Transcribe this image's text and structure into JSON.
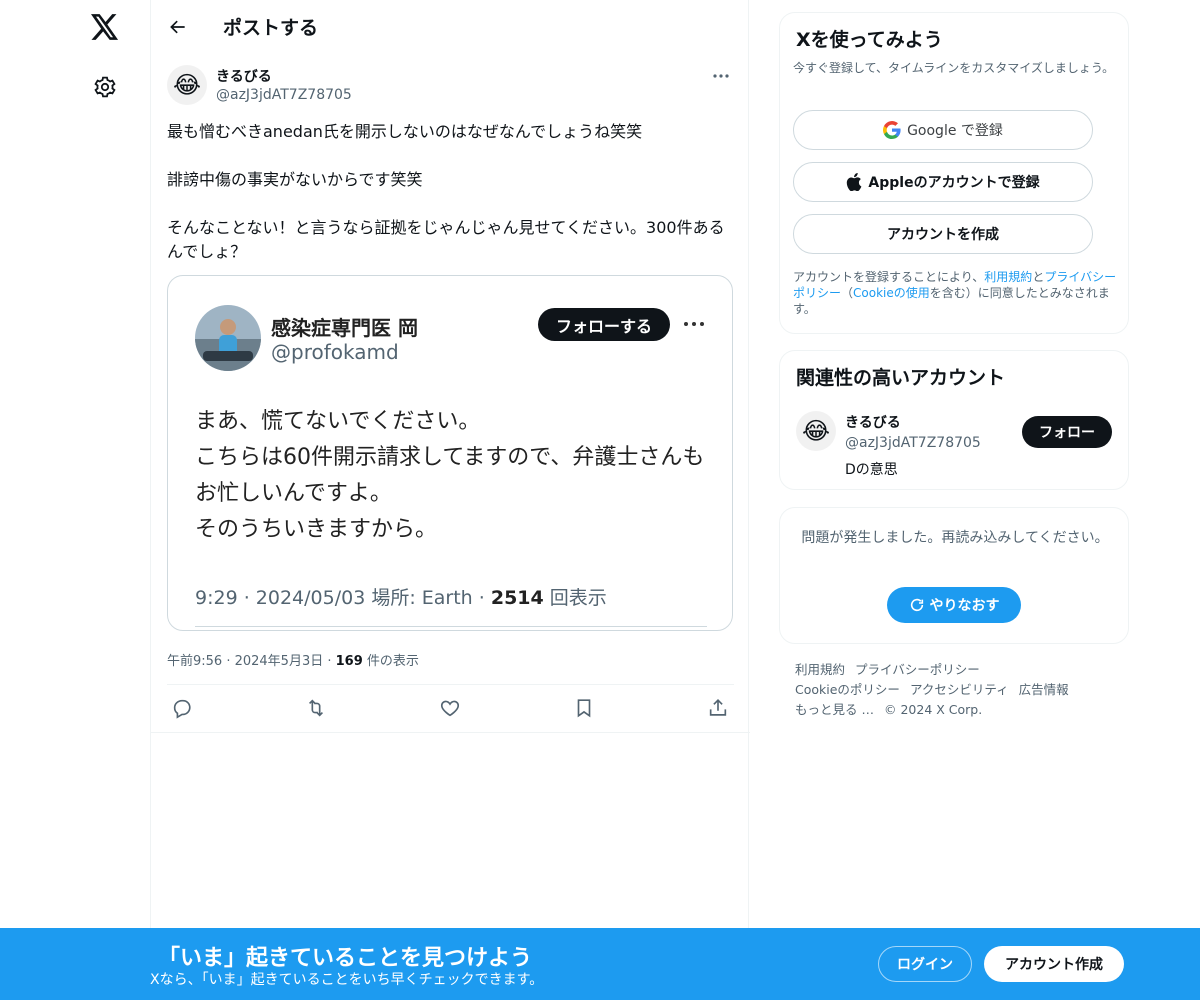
{
  "nav": {
    "logo_icon": "x-logo-icon",
    "settings_icon": "gear-icon"
  },
  "header": {
    "title": "ポストする"
  },
  "post": {
    "author_name": "きるびる",
    "author_handle": "@azJ3jdAT7Z78705",
    "avatar_emoji": "😂",
    "text": "最も憎むべきanedan氏を開示しないのはなぜなんでしょうね笑笑\n\n誹謗中傷の事実がないからです笑笑\n\nそんなことない！と言うなら証拠をじゃんじゃん見せてください。300件あるんでしょ？",
    "embedded": {
      "name": "感染症専門医 岡",
      "handle": "@profokamd",
      "follow_label": "フォローする",
      "body": "まあ、慌てないでください。\nこちらは60件開示請求してますので、弁護士さんもお忙しいんですよ。\nそのうちいきますから。",
      "meta_prefix": "9:29 · 2024/05/03 場所: Earth · ",
      "meta_views": "2514",
      "meta_suffix": " 回表示"
    },
    "time": "午前9:56 · 2024年5月3日 · ",
    "views": "169",
    "views_suffix": " 件の表示"
  },
  "sidebar": {
    "signup_card": {
      "title": "Xを使ってみよう",
      "subtitle": "今すぐ登録して、タイムラインをカスタマイズしましょう。",
      "google_label": "Google で登録",
      "apple_label": "Appleのアカウントで登録",
      "create_label": "アカウントを作成",
      "legal_1": "アカウントを登録することにより、",
      "legal_terms": "利用規約",
      "legal_2": "と",
      "legal_privacy": "プライバシーポリシー",
      "legal_3": "（",
      "legal_cookie": "Cookieの使用",
      "legal_4": "を含む）に同意したとみなされます。"
    },
    "related": {
      "title": "関連性の高いアカウント",
      "name": "きるびる",
      "handle": "@azJ3jdAT7Z78705",
      "bio": "Dの意思",
      "follow_label": "フォロー"
    },
    "error": {
      "text": "問題が発生しました。再読み込みしてください。",
      "retry_label": "やりなおす"
    },
    "footer": {
      "links": [
        "利用規約",
        "プライバシーポリシー",
        "Cookieのポリシー",
        "アクセシビリティ",
        "広告情報",
        "もっと見る …"
      ],
      "copyright": "© 2024 X Corp."
    }
  },
  "banner": {
    "title": "「いま」起きていることを見つけよう",
    "subtitle": "Xなら、「いま」起きていることをいち早くチェックできます。",
    "login_label": "ログイン",
    "signup_label": "アカウント作成"
  },
  "colors": {
    "accent": "#1d9bf0",
    "text": "#0f1419",
    "muted": "#536471"
  }
}
